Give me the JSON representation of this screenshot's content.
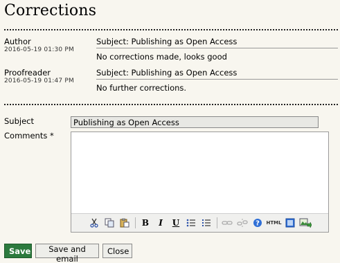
{
  "page": {
    "title": "Corrections"
  },
  "entries": [
    {
      "author": "Author",
      "date": "2016-05-19 01:30 PM",
      "subject": "Subject: Publishing as Open Access",
      "body": "No corrections made, looks good"
    },
    {
      "author": "Proofreader",
      "date": "2016-05-19 01:47 PM",
      "subject": "Subject: Publishing as Open Access",
      "body": "No further corrections."
    }
  ],
  "form": {
    "subject_label": "Subject",
    "subject_value": "Publishing as Open Access",
    "comments_label": "Comments *",
    "comments_value": ""
  },
  "toolbar": {
    "icons": [
      "cut-icon",
      "copy-icon",
      "paste-icon",
      "bold-icon",
      "italic-icon",
      "underline-icon",
      "bullet-list-icon",
      "numbered-list-icon",
      "link-icon",
      "unlink-icon",
      "help-icon",
      "html-icon",
      "fullscreen-icon",
      "insert-image-icon"
    ],
    "bold_glyph": "B",
    "italic_glyph": "I",
    "underline_glyph": "U",
    "html_glyph": "HTML"
  },
  "buttons": {
    "save": "Save",
    "save_email": "Save and email",
    "close": "Close"
  },
  "colors": {
    "background": "#f8f6ef",
    "save_button": "#2c7a3e",
    "help_icon": "#2f6fd6"
  }
}
